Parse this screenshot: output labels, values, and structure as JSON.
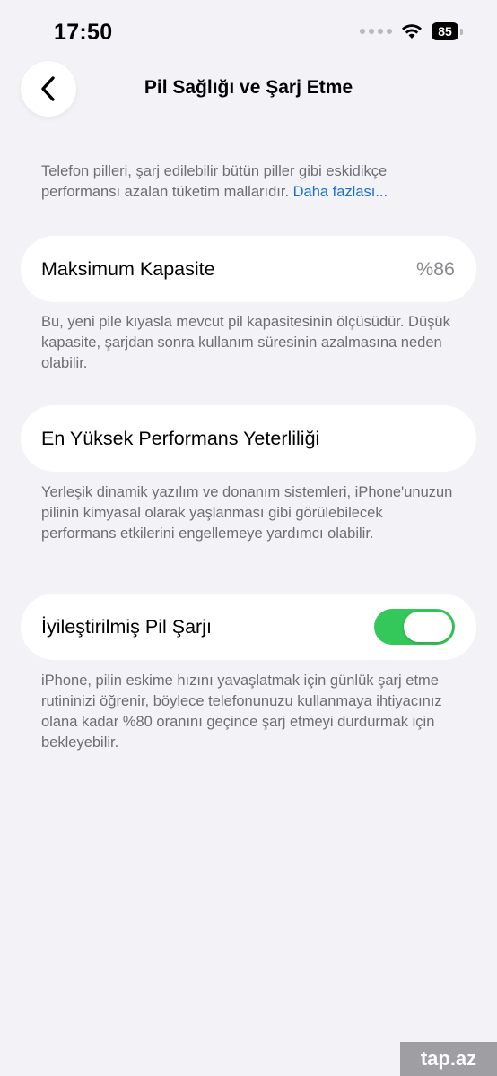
{
  "status_bar": {
    "time": "17:50",
    "battery_level": "85",
    "wifi_icon": "wifi-icon",
    "signal_icon": "cellular-signal-icon"
  },
  "nav": {
    "back_icon": "chevron-left-icon",
    "title": "Pil Sağlığı ve Şarj Etme"
  },
  "intro": {
    "text": "Telefon pilleri, şarj edilebilir bütün piller gibi eskidikçe performansı azalan tüketim mallarıdır. ",
    "link": "Daha fazlası..."
  },
  "max_capacity": {
    "label": "Maksimum Kapasite",
    "value": "%86",
    "footnote": "Bu, yeni pile kıyasla mevcut pil kapasitesinin ölçüsüdür. Düşük kapasite, şarjdan sonra kullanım süresinin azalmasına neden olabilir."
  },
  "peak_performance": {
    "label": "En Yüksek Performans Yeterliliği",
    "footnote": "Yerleşik dinamik yazılım ve donanım sistemleri, iPhone'unuzun pilinin kimyasal olarak yaşlanması gibi görülebilecek performans etkilerini engellemeye yardımcı olabilir."
  },
  "optimized_charging": {
    "label": "İyileştirilmiş Pil Şarjı",
    "enabled": true,
    "footnote": "iPhone, pilin eskime hızını yavaşlatmak için günlük şarj etme rutininizi öğrenir, böylece telefonunuzu kullanmaya ihtiyacınız olana kadar %80 oranını geçince şarj etmeyi durdurmak için bekleyebilir."
  },
  "watermark": {
    "text": "tap.az"
  },
  "colors": {
    "background": "#f2f2f7",
    "toggle_on": "#34c759",
    "link": "#1c6fd1"
  }
}
